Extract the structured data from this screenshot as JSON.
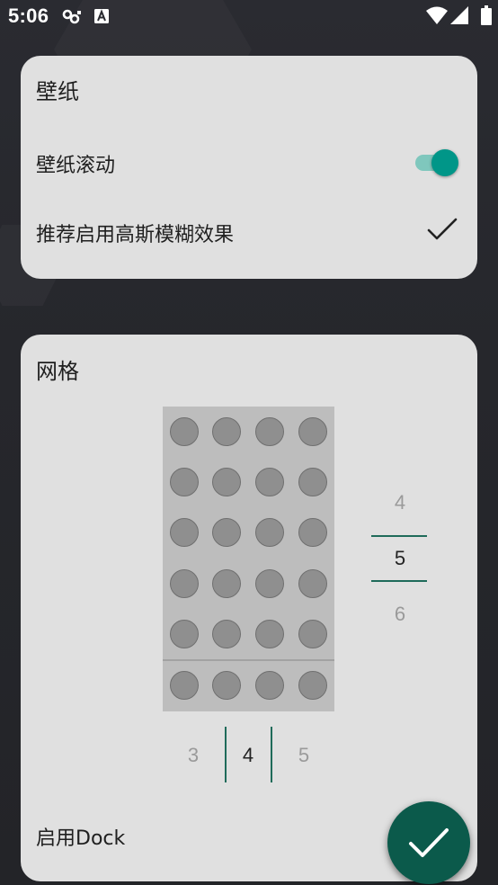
{
  "status_bar": {
    "time": "5:06"
  },
  "wallpaper_card": {
    "title": "壁纸",
    "scroll_label": "壁纸滚动",
    "scroll_enabled": true,
    "blur_label": "推荐启用高斯模糊效果",
    "blur_checked": true
  },
  "grid_card": {
    "title": "网格",
    "rows_picker": {
      "prev": "4",
      "selected": "5",
      "next": "6"
    },
    "cols_picker": {
      "prev": "3",
      "selected": "4",
      "next": "5"
    },
    "dock_label": "启用Dock"
  },
  "colors": {
    "accent": "#009688",
    "fab": "#0b5a4b",
    "card": "#e0e0e0"
  }
}
